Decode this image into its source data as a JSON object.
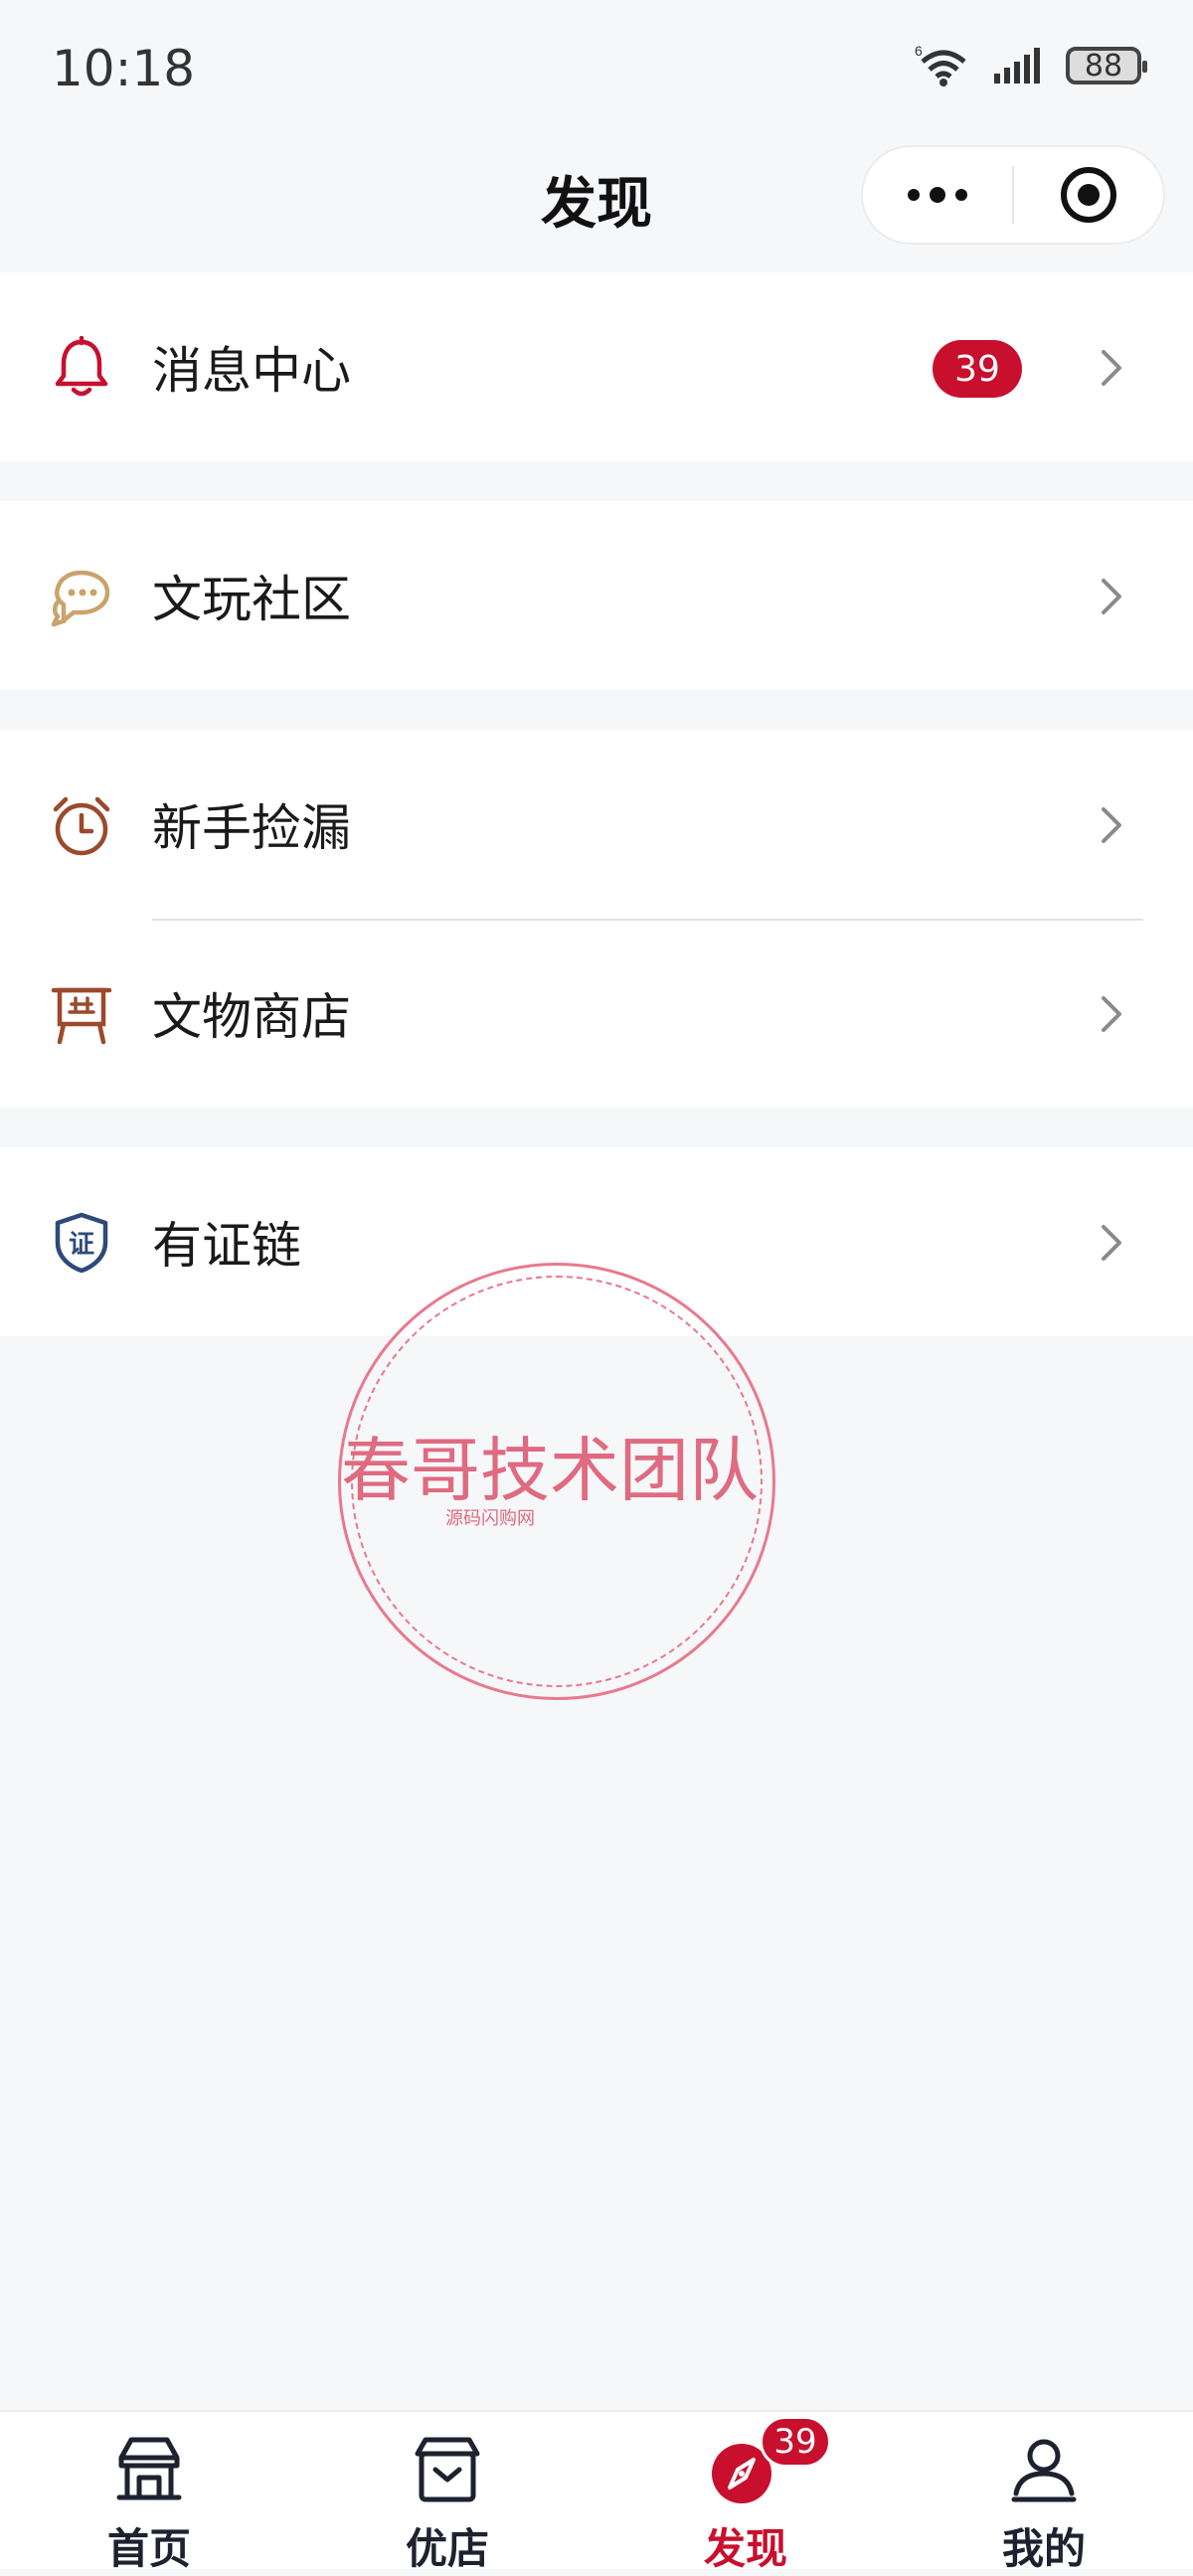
{
  "status_bar": {
    "time": "10:18",
    "battery": "88",
    "network": "6"
  },
  "nav": {
    "title": "发现"
  },
  "menu": {
    "message_center": {
      "label": "消息中心",
      "badge": "39"
    },
    "community": {
      "label": "文玩社区"
    },
    "newbie": {
      "label": "新手捡漏"
    },
    "shop": {
      "label": "文物商店"
    },
    "chain": {
      "label": "有证链"
    }
  },
  "watermark": {
    "title": "春哥技术团队",
    "subtitle": "源码闪购网"
  },
  "tabbar": {
    "items": [
      {
        "label": "首页",
        "icon": "home-icon"
      },
      {
        "label": "优店",
        "icon": "store-icon"
      },
      {
        "label": "发现",
        "icon": "compass-icon",
        "badge": "39",
        "active": true
      },
      {
        "label": "我的",
        "icon": "user-icon"
      }
    ]
  },
  "colors": {
    "accent": "#c8102e",
    "background": "#f6f7f9",
    "gold": "#c9a36b",
    "brown": "#9b4a2c",
    "navy": "#2e4a7a"
  }
}
